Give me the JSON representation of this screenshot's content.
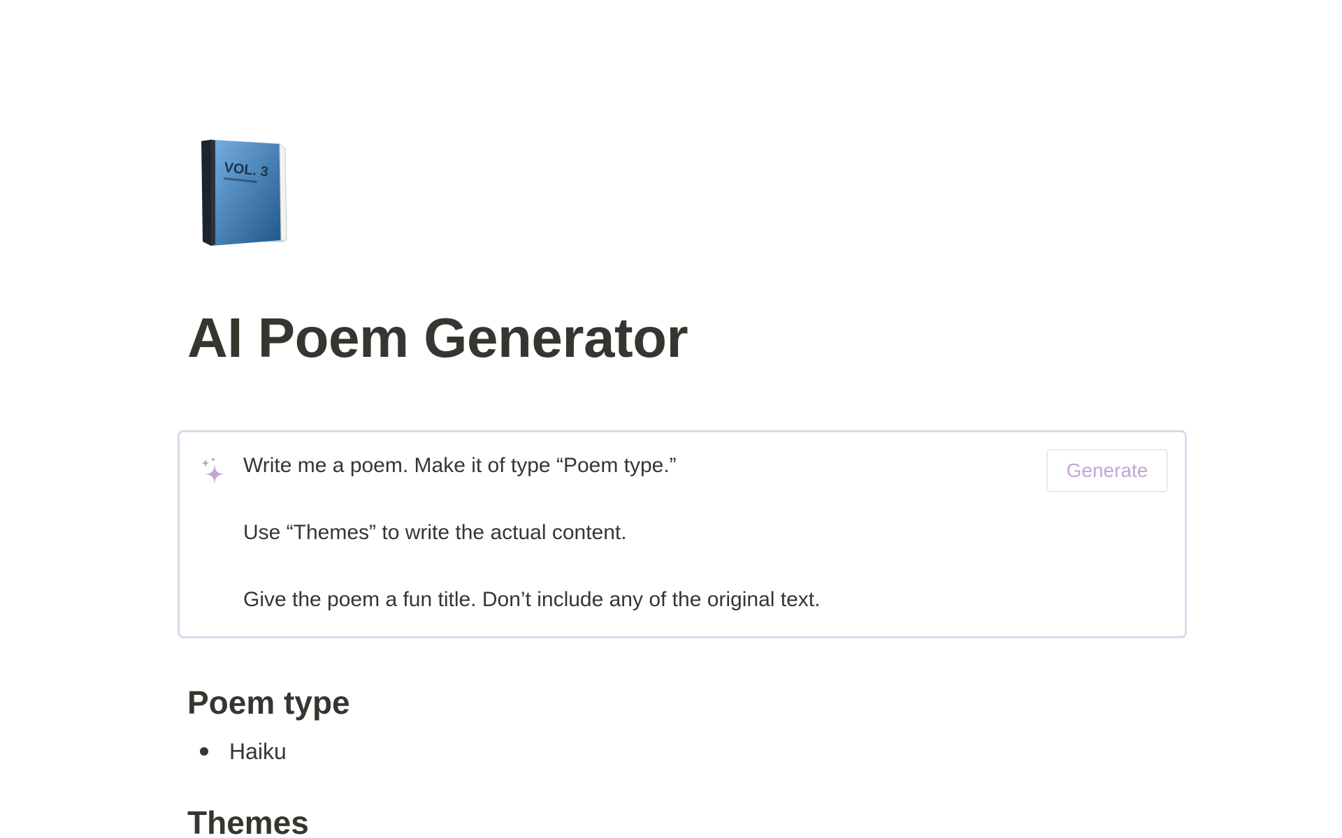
{
  "page": {
    "icon": "blue-book-icon",
    "icon_text": "VOL. 3",
    "title": "AI Poem Generator"
  },
  "ai_block": {
    "icon": "sparkle-icon",
    "lines": [
      "Write me a poem. Make it of type “Poem type.”",
      "Use “Themes” to write the actual content.",
      "Give the poem a fun title. Don’t include any of the original text."
    ],
    "generate_label": "Generate",
    "border_color": "#e3d5ea",
    "accent_color": "#c4a4d6"
  },
  "sections": [
    {
      "heading": "Poem type",
      "items": [
        "Haiku"
      ]
    },
    {
      "heading": "Themes",
      "items": []
    }
  ]
}
